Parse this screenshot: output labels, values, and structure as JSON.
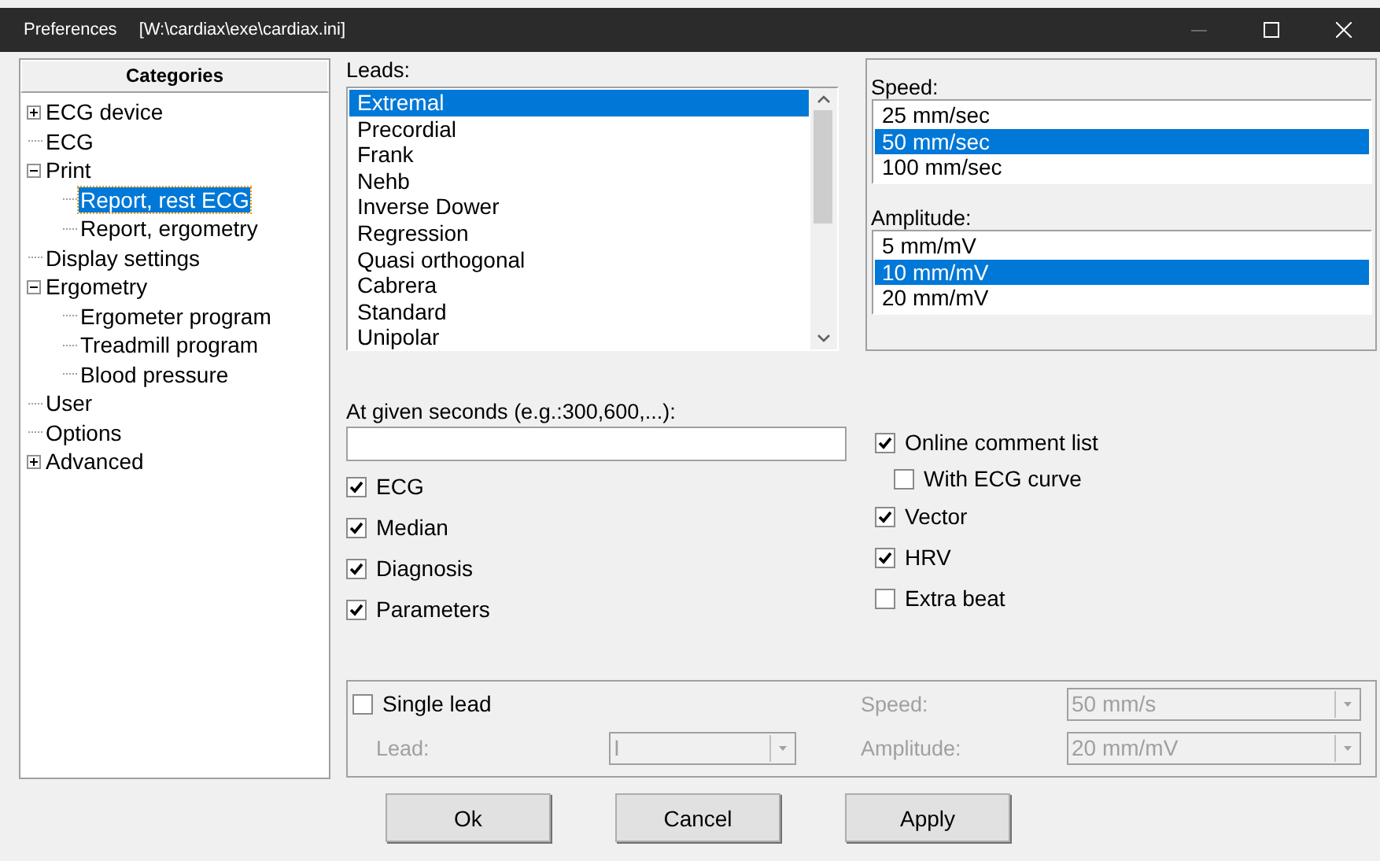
{
  "window": {
    "title": "Preferences",
    "path": "[W:\\cardiax\\exe\\cardiax.ini]"
  },
  "sidebar": {
    "header": "Categories",
    "items": [
      {
        "label": "ECG device",
        "selected": false,
        "expanded": false
      },
      {
        "label": "ECG",
        "selected": false
      },
      {
        "label": "Print",
        "selected": false,
        "expanded": true,
        "children": [
          {
            "label": "Report, rest ECG",
            "selected": true
          },
          {
            "label": "Report, ergometry",
            "selected": false
          }
        ]
      },
      {
        "label": "Display settings",
        "selected": false
      },
      {
        "label": "Ergometry",
        "selected": false,
        "expanded": true,
        "children": [
          {
            "label": "Ergometer program",
            "selected": false
          },
          {
            "label": "Treadmill program",
            "selected": false
          },
          {
            "label": "Blood pressure",
            "selected": false
          }
        ]
      },
      {
        "label": "User",
        "selected": false
      },
      {
        "label": "Options",
        "selected": false
      },
      {
        "label": "Advanced",
        "selected": false,
        "expanded": false
      }
    ]
  },
  "leads": {
    "label": "Leads:",
    "items": [
      {
        "label": "Extremal",
        "selected": true
      },
      {
        "label": "Precordial",
        "selected": false
      },
      {
        "label": "Frank",
        "selected": false
      },
      {
        "label": "Nehb",
        "selected": false
      },
      {
        "label": "Inverse Dower",
        "selected": false
      },
      {
        "label": "Regression",
        "selected": false
      },
      {
        "label": "Quasi orthogonal",
        "selected": false
      },
      {
        "label": "Cabrera",
        "selected": false
      },
      {
        "label": "Standard",
        "selected": false
      },
      {
        "label": "Unipolar",
        "selected": false
      }
    ]
  },
  "speed": {
    "label": "Speed:",
    "items": [
      {
        "label": "25 mm/sec",
        "selected": false
      },
      {
        "label": "50 mm/sec",
        "selected": true
      },
      {
        "label": "100 mm/sec",
        "selected": false
      }
    ]
  },
  "amplitude": {
    "label": "Amplitude:",
    "items": [
      {
        "label": "5 mm/mV",
        "selected": false
      },
      {
        "label": "10 mm/mV",
        "selected": true
      },
      {
        "label": "20 mm/mV",
        "selected": false
      }
    ]
  },
  "seconds_field": {
    "label": "At given seconds (e.g.:300,600,...):"
  },
  "options_left": [
    {
      "label": "ECG",
      "checked": true
    },
    {
      "label": "Median",
      "checked": true
    },
    {
      "label": "Diagnosis",
      "checked": true
    },
    {
      "label": "Parameters",
      "checked": true
    }
  ],
  "options_right": [
    {
      "label": "Online comment list",
      "checked": true,
      "children": [
        {
          "label": "With ECG curve",
          "checked": false
        }
      ]
    },
    {
      "label": "Vector",
      "checked": true
    },
    {
      "label": "HRV",
      "checked": true
    },
    {
      "label": "Extra beat",
      "checked": false
    }
  ],
  "single_lead": {
    "label": "Single lead",
    "checked": false,
    "lead": {
      "label": "Lead:",
      "value": "I",
      "disabled": true
    },
    "speed": {
      "label": "Speed:",
      "value": "50 mm/s",
      "disabled": true
    },
    "amplitude": {
      "label": "Amplitude:",
      "value": "20 mm/mV",
      "disabled": true
    }
  },
  "buttons": [
    "Ok",
    "Cancel",
    "Apply"
  ]
}
